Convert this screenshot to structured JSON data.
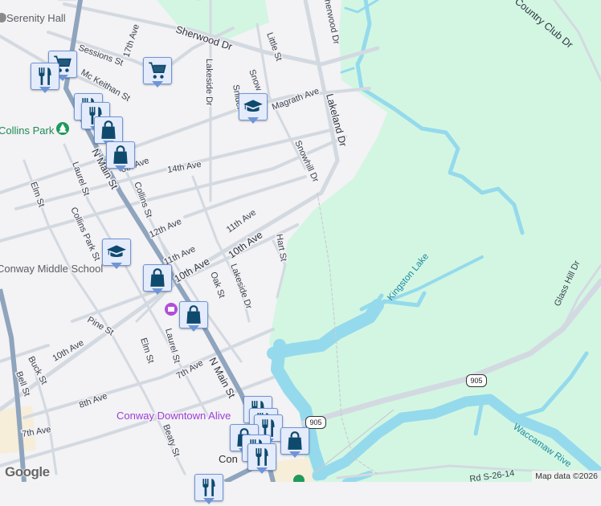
{
  "map": {
    "colors": {
      "land": "#f3f2f4",
      "park": "#d3f6e3",
      "water": "#95daec",
      "road": "#d3d9e1",
      "highway": "#8fa4bd",
      "marker_bg": "#e4ebfb",
      "marker_icon": "#0e4a6e"
    },
    "pois": {
      "serenity_hall": "Serenity Hall",
      "collins_park": "Collins Park",
      "conway_middle_school": "Conway Middle School",
      "conway_downtown_alive": "Conway Downtown Alive",
      "conway": "Con"
    },
    "streets": {
      "sherwood_dr": "Sherwood Dr",
      "sessions_st": "Sessions St",
      "ave17": "17th Ave",
      "mc_keithan": "Mc Keithan St",
      "little_st": "Little St",
      "lakeside_top": "Lakeside Dr",
      "snow": "Snow",
      "snider": "Snider",
      "magrath": "Magrath Ave",
      "herwood": "herwood Dr",
      "lakeland": "Lakeland Dr",
      "snowhill": "Snowhill Dr",
      "ave14": "14th Ave",
      "ave10_partial": "0th Ave",
      "n_main_top": "N Main St",
      "laurel_top": "Laurel St",
      "elm_top": "Elm St",
      "collins_st": "Collins St",
      "collins_park_st": "Collins Park St",
      "ave12": "12th Ave",
      "ave11_right": "11th Ave",
      "ave11_left": "11th Ave",
      "ave10_right": "10th Ave",
      "ave10_mid": "10th Ave",
      "hart_st": "Hart St",
      "oak_st": "Oak St",
      "lakeside_low": "Lakeside Dr",
      "pine_st": "Pine St",
      "ave10_left": "10th Ave",
      "buck_st": "Buck St",
      "bell_st": "Bell St",
      "elm_low": "Elm St",
      "laurel_low": "Laurel St",
      "ave7_right": "7th Ave",
      "n_main_low": "N Main St",
      "ave8": "8th Ave",
      "ave7_left": "7th Ave",
      "beaty_st": "Beaty St",
      "glass_hill": "Glass Hill Dr",
      "rd_s2614": "Rd S-26-14",
      "country_club": "Country Club Dr"
    },
    "water": {
      "kingston_lake": "Kingston Lake",
      "waccamaw": "Waccamaw Rive"
    },
    "route_shields": [
      "905",
      "905"
    ],
    "attribution": "Map data ©2026",
    "logo": "Google"
  }
}
